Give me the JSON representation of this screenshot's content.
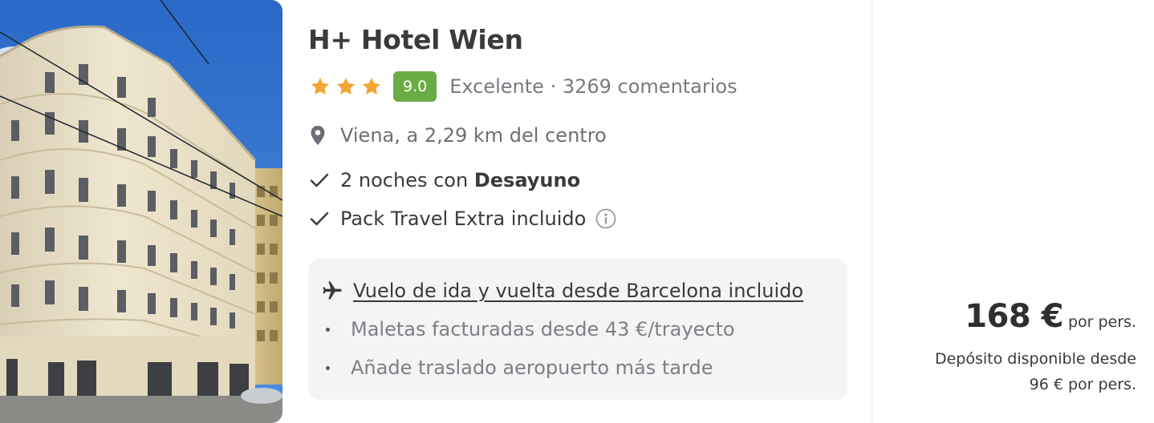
{
  "hotel": {
    "name": "H+ Hotel Wien",
    "stars": 3,
    "score": "9.0",
    "rating_label": "Excelente · 3269 comentarios",
    "location": "Viena, a 2,29 km del centro",
    "features": [
      {
        "text": "2 noches con ",
        "bold": "Desayuno"
      },
      {
        "text": "Pack Travel Extra incluido"
      }
    ]
  },
  "flight": {
    "title": "Vuelo de ida y vuelta desde Barcelona incluido",
    "items": [
      "Maletas facturadas desde 43 €/trayecto",
      "Añade traslado aeropuerto más tarde"
    ]
  },
  "price": {
    "amount": "168 €",
    "unit": "por pers.",
    "deposit_line1": "Depósito disponible desde",
    "deposit_line2": "96 € por pers."
  },
  "colors": {
    "score_badge": "#6aac44",
    "star": "#f2a533",
    "flight_box_bg": "#f4f4f5"
  },
  "icons": {
    "stars": "star-icon",
    "location": "map-pin-icon",
    "check": "checkmark-icon",
    "info": "info-icon",
    "flight": "airplane-icon"
  }
}
